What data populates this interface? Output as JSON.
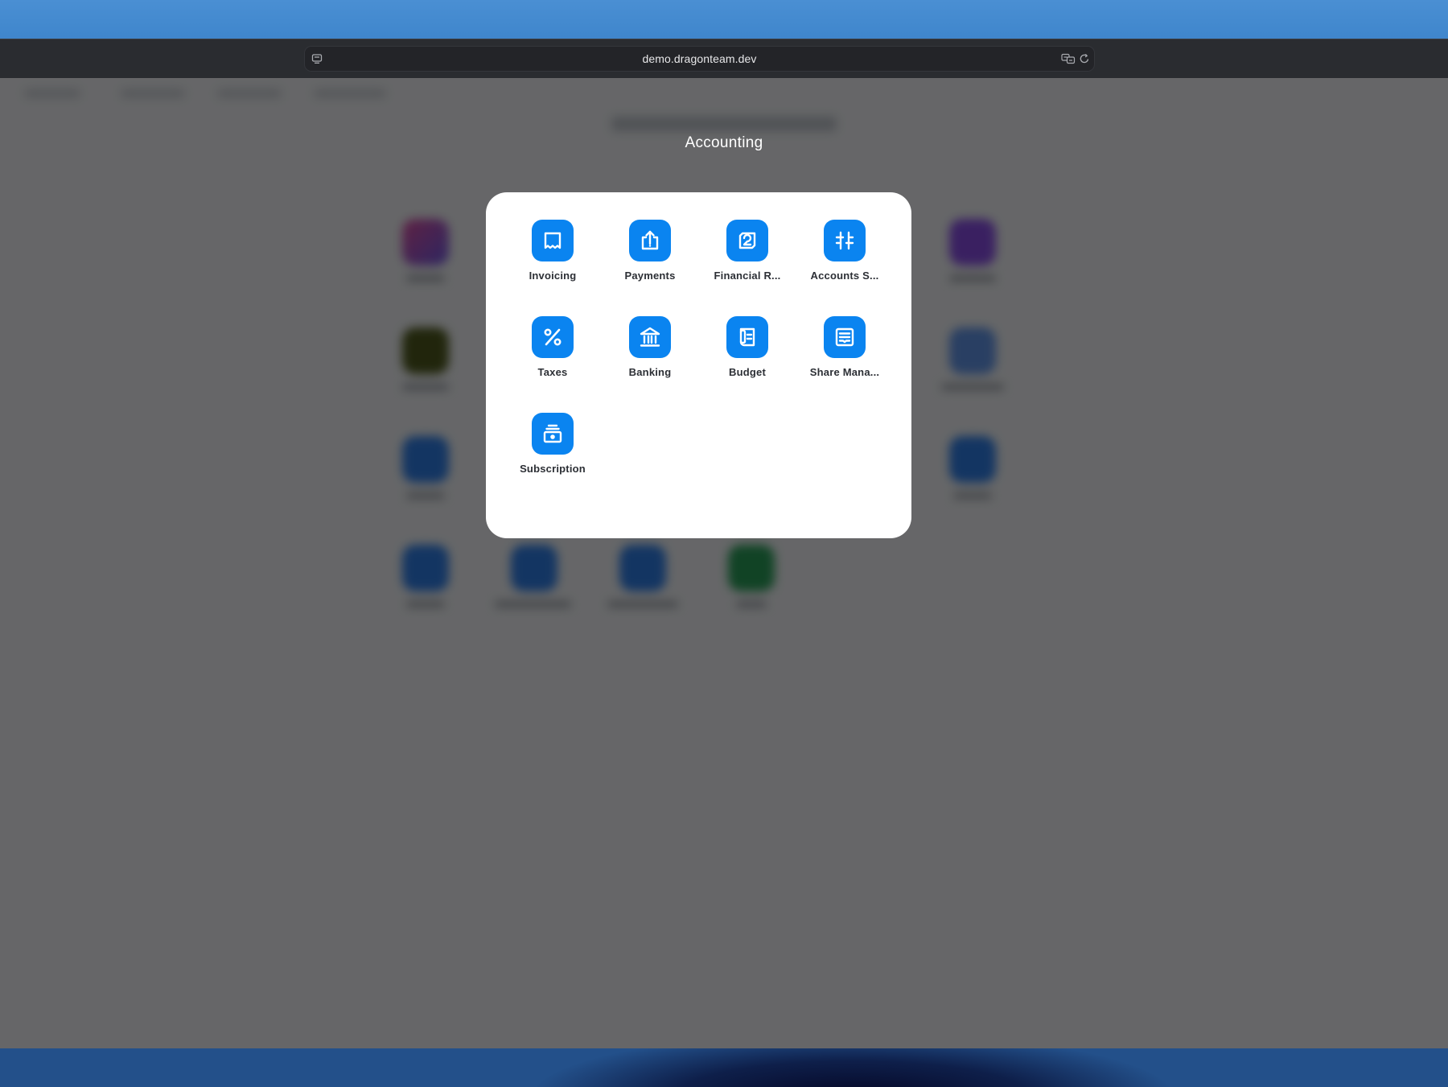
{
  "browser": {
    "url": "demo.dragonteam.dev"
  },
  "folder": {
    "title": "Accounting",
    "apps": [
      {
        "label": "Invoicing",
        "icon": "receipt-icon"
      },
      {
        "label": "Payments",
        "icon": "upload-tray-icon"
      },
      {
        "label": "Financial R...",
        "icon": "report-chart-icon"
      },
      {
        "label": "Accounts S...",
        "icon": "sliders-icon"
      },
      {
        "label": "Taxes",
        "icon": "percent-icon"
      },
      {
        "label": "Banking",
        "icon": "bank-icon"
      },
      {
        "label": "Budget",
        "icon": "ledger-icon"
      },
      {
        "label": "Share Mana...",
        "icon": "stack-card-icon"
      },
      {
        "label": "Subscription",
        "icon": "archive-box-icon"
      }
    ]
  },
  "colors": {
    "app_tile": "#0a84f0",
    "overlay": "rgba(0,0,0,0.58)",
    "chrome": "#2a2c30"
  }
}
